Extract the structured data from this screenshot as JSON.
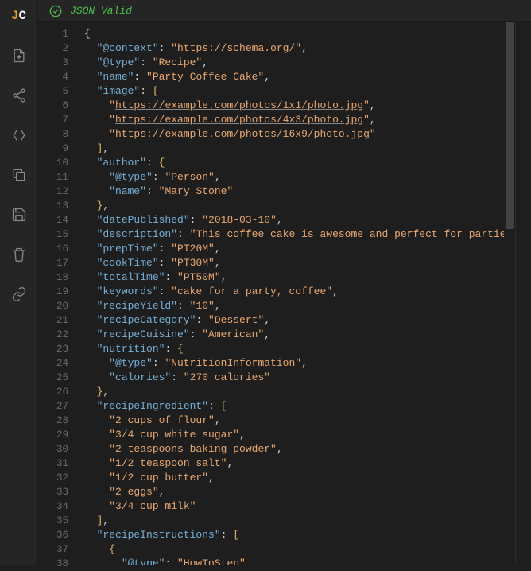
{
  "logo": {
    "j": "J",
    "c": "C"
  },
  "status": {
    "text": "JSON Valid"
  },
  "lines": [
    {
      "n": 1,
      "seg": [
        {
          "c": "p",
          "t": "{"
        }
      ]
    },
    {
      "n": 2,
      "seg": [
        {
          "c": "p",
          "t": "  "
        },
        {
          "c": "k",
          "t": "\"@context\""
        },
        {
          "c": "p",
          "t": ": "
        },
        {
          "c": "s",
          "t": "\""
        },
        {
          "c": "l",
          "t": "https://schema.org/"
        },
        {
          "c": "s",
          "t": "\""
        },
        {
          "c": "p",
          "t": ","
        }
      ]
    },
    {
      "n": 3,
      "seg": [
        {
          "c": "p",
          "t": "  "
        },
        {
          "c": "k",
          "t": "\"@type\""
        },
        {
          "c": "p",
          "t": ": "
        },
        {
          "c": "s",
          "t": "\"Recipe\""
        },
        {
          "c": "p",
          "t": ","
        }
      ]
    },
    {
      "n": 4,
      "seg": [
        {
          "c": "p",
          "t": "  "
        },
        {
          "c": "k",
          "t": "\"name\""
        },
        {
          "c": "p",
          "t": ": "
        },
        {
          "c": "s",
          "t": "\"Party Coffee Cake\""
        },
        {
          "c": "p",
          "t": ","
        }
      ]
    },
    {
      "n": 5,
      "seg": [
        {
          "c": "p",
          "t": "  "
        },
        {
          "c": "k",
          "t": "\"image\""
        },
        {
          "c": "p",
          "t": ": "
        },
        {
          "c": "b",
          "t": "["
        }
      ]
    },
    {
      "n": 6,
      "seg": [
        {
          "c": "p",
          "t": "    "
        },
        {
          "c": "s",
          "t": "\""
        },
        {
          "c": "l",
          "t": "https://example.com/photos/1x1/photo.jpg"
        },
        {
          "c": "s",
          "t": "\""
        },
        {
          "c": "p",
          "t": ","
        }
      ]
    },
    {
      "n": 7,
      "seg": [
        {
          "c": "p",
          "t": "    "
        },
        {
          "c": "s",
          "t": "\""
        },
        {
          "c": "l",
          "t": "https://example.com/photos/4x3/photo.jpg"
        },
        {
          "c": "s",
          "t": "\""
        },
        {
          "c": "p",
          "t": ","
        }
      ]
    },
    {
      "n": 8,
      "seg": [
        {
          "c": "p",
          "t": "    "
        },
        {
          "c": "s",
          "t": "\""
        },
        {
          "c": "l",
          "t": "https://example.com/photos/16x9/photo.jpg"
        },
        {
          "c": "s",
          "t": "\""
        }
      ]
    },
    {
      "n": 9,
      "seg": [
        {
          "c": "p",
          "t": "  "
        },
        {
          "c": "b",
          "t": "]"
        },
        {
          "c": "p",
          "t": ","
        }
      ]
    },
    {
      "n": 10,
      "seg": [
        {
          "c": "p",
          "t": "  "
        },
        {
          "c": "k",
          "t": "\"author\""
        },
        {
          "c": "p",
          "t": ": "
        },
        {
          "c": "b",
          "t": "{"
        }
      ]
    },
    {
      "n": 11,
      "seg": [
        {
          "c": "p",
          "t": "    "
        },
        {
          "c": "k",
          "t": "\"@type\""
        },
        {
          "c": "p",
          "t": ": "
        },
        {
          "c": "s",
          "t": "\"Person\""
        },
        {
          "c": "p",
          "t": ","
        }
      ]
    },
    {
      "n": 12,
      "seg": [
        {
          "c": "p",
          "t": "    "
        },
        {
          "c": "k",
          "t": "\"name\""
        },
        {
          "c": "p",
          "t": ": "
        },
        {
          "c": "s",
          "t": "\"Mary Stone\""
        }
      ]
    },
    {
      "n": 13,
      "seg": [
        {
          "c": "p",
          "t": "  "
        },
        {
          "c": "b",
          "t": "}"
        },
        {
          "c": "p",
          "t": ","
        }
      ]
    },
    {
      "n": 14,
      "seg": [
        {
          "c": "p",
          "t": "  "
        },
        {
          "c": "k",
          "t": "\"datePublished\""
        },
        {
          "c": "p",
          "t": ": "
        },
        {
          "c": "s",
          "t": "\"2018-03-10\""
        },
        {
          "c": "p",
          "t": ","
        }
      ]
    },
    {
      "n": 15,
      "seg": [
        {
          "c": "p",
          "t": "  "
        },
        {
          "c": "k",
          "t": "\"description\""
        },
        {
          "c": "p",
          "t": ": "
        },
        {
          "c": "s",
          "t": "\"This coffee cake is awesome and perfect for parties.\""
        },
        {
          "c": "p",
          "t": ","
        }
      ]
    },
    {
      "n": 16,
      "seg": [
        {
          "c": "p",
          "t": "  "
        },
        {
          "c": "k",
          "t": "\"prepTime\""
        },
        {
          "c": "p",
          "t": ": "
        },
        {
          "c": "s",
          "t": "\"PT20M\""
        },
        {
          "c": "p",
          "t": ","
        }
      ]
    },
    {
      "n": 17,
      "seg": [
        {
          "c": "p",
          "t": "  "
        },
        {
          "c": "k",
          "t": "\"cookTime\""
        },
        {
          "c": "p",
          "t": ": "
        },
        {
          "c": "s",
          "t": "\"PT30M\""
        },
        {
          "c": "p",
          "t": ","
        }
      ]
    },
    {
      "n": 18,
      "seg": [
        {
          "c": "p",
          "t": "  "
        },
        {
          "c": "k",
          "t": "\"totalTime\""
        },
        {
          "c": "p",
          "t": ": "
        },
        {
          "c": "s",
          "t": "\"PT50M\""
        },
        {
          "c": "p",
          "t": ","
        }
      ]
    },
    {
      "n": 19,
      "seg": [
        {
          "c": "p",
          "t": "  "
        },
        {
          "c": "k",
          "t": "\"keywords\""
        },
        {
          "c": "p",
          "t": ": "
        },
        {
          "c": "s",
          "t": "\"cake for a party, coffee\""
        },
        {
          "c": "p",
          "t": ","
        }
      ]
    },
    {
      "n": 20,
      "seg": [
        {
          "c": "p",
          "t": "  "
        },
        {
          "c": "k",
          "t": "\"recipeYield\""
        },
        {
          "c": "p",
          "t": ": "
        },
        {
          "c": "s",
          "t": "\"10\""
        },
        {
          "c": "p",
          "t": ","
        }
      ]
    },
    {
      "n": 21,
      "seg": [
        {
          "c": "p",
          "t": "  "
        },
        {
          "c": "k",
          "t": "\"recipeCategory\""
        },
        {
          "c": "p",
          "t": ": "
        },
        {
          "c": "s",
          "t": "\"Dessert\""
        },
        {
          "c": "p",
          "t": ","
        }
      ]
    },
    {
      "n": 22,
      "seg": [
        {
          "c": "p",
          "t": "  "
        },
        {
          "c": "k",
          "t": "\"recipeCuisine\""
        },
        {
          "c": "p",
          "t": ": "
        },
        {
          "c": "s",
          "t": "\"American\""
        },
        {
          "c": "p",
          "t": ","
        }
      ]
    },
    {
      "n": 23,
      "seg": [
        {
          "c": "p",
          "t": "  "
        },
        {
          "c": "k",
          "t": "\"nutrition\""
        },
        {
          "c": "p",
          "t": ": "
        },
        {
          "c": "b",
          "t": "{"
        }
      ]
    },
    {
      "n": 24,
      "seg": [
        {
          "c": "p",
          "t": "    "
        },
        {
          "c": "k",
          "t": "\"@type\""
        },
        {
          "c": "p",
          "t": ": "
        },
        {
          "c": "s",
          "t": "\"NutritionInformation\""
        },
        {
          "c": "p",
          "t": ","
        }
      ]
    },
    {
      "n": 25,
      "seg": [
        {
          "c": "p",
          "t": "    "
        },
        {
          "c": "k",
          "t": "\"calories\""
        },
        {
          "c": "p",
          "t": ": "
        },
        {
          "c": "s",
          "t": "\"270 calories\""
        }
      ]
    },
    {
      "n": 26,
      "seg": [
        {
          "c": "p",
          "t": "  "
        },
        {
          "c": "b",
          "t": "}"
        },
        {
          "c": "p",
          "t": ","
        }
      ]
    },
    {
      "n": 27,
      "seg": [
        {
          "c": "p",
          "t": "  "
        },
        {
          "c": "k",
          "t": "\"recipeIngredient\""
        },
        {
          "c": "p",
          "t": ": "
        },
        {
          "c": "b",
          "t": "["
        }
      ]
    },
    {
      "n": 28,
      "seg": [
        {
          "c": "p",
          "t": "    "
        },
        {
          "c": "s",
          "t": "\"2 cups of flour\""
        },
        {
          "c": "p",
          "t": ","
        }
      ]
    },
    {
      "n": 29,
      "seg": [
        {
          "c": "p",
          "t": "    "
        },
        {
          "c": "s",
          "t": "\"3/4 cup white sugar\""
        },
        {
          "c": "p",
          "t": ","
        }
      ]
    },
    {
      "n": 30,
      "seg": [
        {
          "c": "p",
          "t": "    "
        },
        {
          "c": "s",
          "t": "\"2 teaspoons baking powder\""
        },
        {
          "c": "p",
          "t": ","
        }
      ]
    },
    {
      "n": 31,
      "seg": [
        {
          "c": "p",
          "t": "    "
        },
        {
          "c": "s",
          "t": "\"1/2 teaspoon salt\""
        },
        {
          "c": "p",
          "t": ","
        }
      ]
    },
    {
      "n": 32,
      "seg": [
        {
          "c": "p",
          "t": "    "
        },
        {
          "c": "s",
          "t": "\"1/2 cup butter\""
        },
        {
          "c": "p",
          "t": ","
        }
      ]
    },
    {
      "n": 33,
      "seg": [
        {
          "c": "p",
          "t": "    "
        },
        {
          "c": "s",
          "t": "\"2 eggs\""
        },
        {
          "c": "p",
          "t": ","
        }
      ]
    },
    {
      "n": 34,
      "seg": [
        {
          "c": "p",
          "t": "    "
        },
        {
          "c": "s",
          "t": "\"3/4 cup milk\""
        }
      ]
    },
    {
      "n": 35,
      "seg": [
        {
          "c": "p",
          "t": "  "
        },
        {
          "c": "b",
          "t": "]"
        },
        {
          "c": "p",
          "t": ","
        }
      ]
    },
    {
      "n": 36,
      "seg": [
        {
          "c": "p",
          "t": "  "
        },
        {
          "c": "k",
          "t": "\"recipeInstructions\""
        },
        {
          "c": "p",
          "t": ": "
        },
        {
          "c": "b",
          "t": "["
        }
      ]
    },
    {
      "n": 37,
      "seg": [
        {
          "c": "p",
          "t": "    "
        },
        {
          "c": "b",
          "t": "{"
        }
      ]
    },
    {
      "n": 38,
      "seg": [
        {
          "c": "p",
          "t": "      "
        },
        {
          "c": "k",
          "t": "\"@type\""
        },
        {
          "c": "p",
          "t": ": "
        },
        {
          "c": "s",
          "t": "\"HowToStep\""
        },
        {
          "c": "p",
          "t": ","
        }
      ]
    }
  ]
}
